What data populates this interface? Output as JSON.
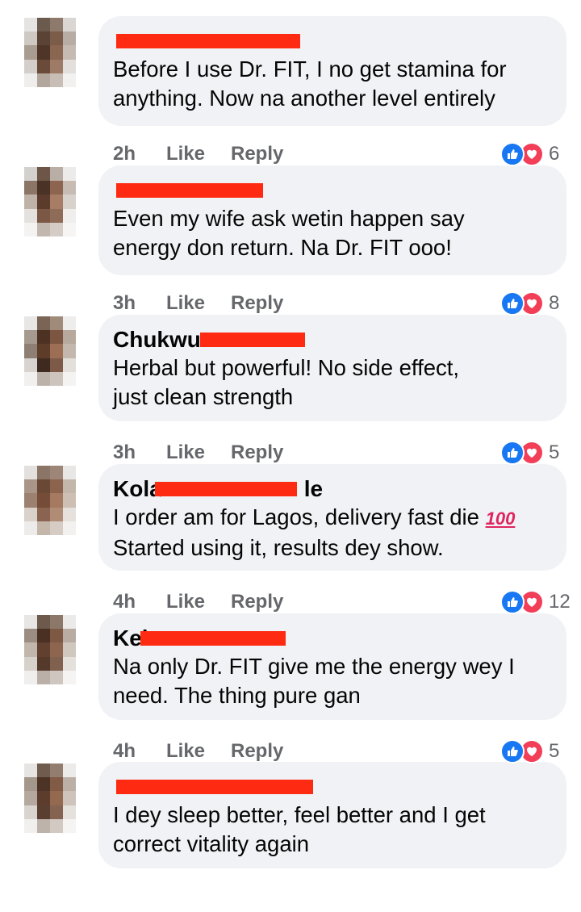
{
  "colors": {
    "bubble_bg": "#f0f2f5",
    "meta_text": "#65676b",
    "like_blue": "#1877f2",
    "love_red": "#f33e58",
    "redaction_red": "#ff2a12"
  },
  "comments": [
    {
      "name_visible": "",
      "lines": [
        "Before I use Dr. FIT, I no get stamina for",
        "anything. Now na another level entirely"
      ],
      "time": "2h",
      "like_label": "Like",
      "reply_label": "Reply",
      "reaction_icons": [
        "like-icon",
        "love-icon"
      ],
      "reaction_count": "6"
    },
    {
      "name_visible": "",
      "lines": [
        "Even my wife ask wetin happen say",
        "energy don return. Na Dr. FIT ooo!"
      ],
      "time": "3h",
      "like_label": "Like",
      "reply_label": "Reply",
      "reaction_icons": [
        "like-icon",
        "love-icon"
      ],
      "reaction_count": "8"
    },
    {
      "name_visible": "Chukwu",
      "lines": [
        "Herbal but powerful! No side effect,",
        "just clean strength"
      ],
      "time": "3h",
      "like_label": "Like",
      "reply_label": "Reply",
      "reaction_icons": [
        "like-icon",
        "love-icon"
      ],
      "reaction_count": "5"
    },
    {
      "name_visible": "Kola",
      "name_suffix": "le",
      "lines": [
        "I order am for Lagos, delivery fast die",
        "Started using it, results dey show."
      ],
      "emoji": "100",
      "time": "4h",
      "like_label": "Like",
      "reply_label": "Reply",
      "reaction_icons": [
        "like-icon",
        "love-icon"
      ],
      "reaction_count": "12"
    },
    {
      "name_visible": "Kel",
      "lines": [
        "Na only Dr. FIT give me the energy wey I",
        "need. The thing pure gan"
      ],
      "time": "4h",
      "like_label": "Like",
      "reply_label": "Reply",
      "reaction_icons": [
        "like-icon",
        "love-icon"
      ],
      "reaction_count": "5"
    },
    {
      "name_visible": "",
      "lines": [
        "I dey sleep better, feel better and I get",
        "correct vitality again"
      ]
    }
  ]
}
